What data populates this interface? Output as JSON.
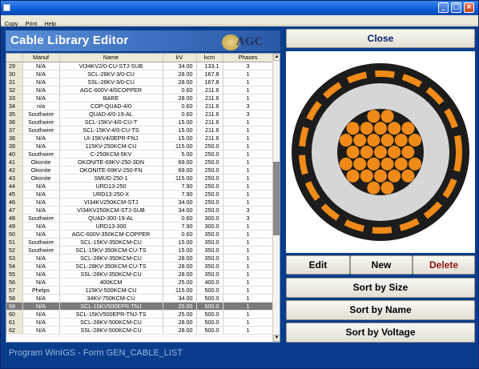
{
  "window": {
    "title": ""
  },
  "menu": [
    "Copy",
    "Print",
    "Help"
  ],
  "header": {
    "title": "Cable Library Editor",
    "logo_text": "AGC"
  },
  "buttons": {
    "close": "Close",
    "edit": "Edit",
    "new": "New",
    "delete": "Delete",
    "sort_size": "Sort by Size",
    "sort_name": "Sort by Name",
    "sort_voltage": "Sort by Voltage"
  },
  "status": "Program WinIGS - Form GEN_CABLE_LIST",
  "table": {
    "columns": [
      "",
      "Manuf",
      "Name",
      "kV",
      "kcm",
      "Phases"
    ],
    "rows": [
      [
        "29",
        "N/A",
        "VI34KV2/0-CU-STJ-SUB",
        "34.00",
        "133.1",
        "3"
      ],
      [
        "30",
        "N/A",
        "SCL-28KV-3/0-CU",
        "28.00",
        "167.8",
        "1"
      ],
      [
        "31",
        "N/A",
        "SSL-28KV-3/0-CU",
        "28.00",
        "167.8",
        "1"
      ],
      [
        "32",
        "N/A",
        "AGC-600V-4/0COPPER",
        "0.60",
        "211.6",
        "1"
      ],
      [
        "33",
        "N/A",
        "BARE",
        "28.00",
        "211.6",
        "1"
      ],
      [
        "34",
        "n/a",
        "COP-QUAD-4/0",
        "0.60",
        "211.6",
        "3"
      ],
      [
        "35",
        "Southwire",
        "QUAD-4/0-19-AL",
        "0.60",
        "211.6",
        "3"
      ],
      [
        "36",
        "Southwire",
        "SCL-15KV-4/0-CU-T",
        "15.00",
        "211.6",
        "1"
      ],
      [
        "37",
        "Southwire",
        "SCL-15KV-4/0-CU-TS",
        "15.00",
        "211.6",
        "1"
      ],
      [
        "38",
        "N/A",
        "UI-15KV4/0EPR-FNJ",
        "15.00",
        "211.6",
        "1"
      ],
      [
        "39",
        "N/A",
        "115KV-250KCM-CU",
        "115.00",
        "250.0",
        "1"
      ],
      [
        "40",
        "Southwire",
        "C-250KCM-5KV",
        "5.00",
        "250.0",
        "1"
      ],
      [
        "41",
        "Okonite",
        "OKONITE-69KV-250-3DN",
        "69.00",
        "250.0",
        "1"
      ],
      [
        "42",
        "Okonite",
        "OKONITE-69KV-250-FN",
        "69.00",
        "250.0",
        "1"
      ],
      [
        "43",
        "Okonite",
        "SMUD-250-1",
        "115.00",
        "250.0",
        "1"
      ],
      [
        "44",
        "N/A",
        "URD13-250",
        "7.90",
        "250.0",
        "1"
      ],
      [
        "45",
        "N/A",
        "URD13-250-X",
        "7.90",
        "250.0",
        "1"
      ],
      [
        "46",
        "N/A",
        "VI34KV250KCM-STJ",
        "34.00",
        "250.0",
        "1"
      ],
      [
        "47",
        "N/A",
        "VI34KV250KCM-STJ-SUB",
        "34.00",
        "250.0",
        "3"
      ],
      [
        "48",
        "Southwire",
        "QUAD-300-19-AL",
        "0.60",
        "300.0",
        "3"
      ],
      [
        "49",
        "N/A",
        "URD13-300",
        "7.90",
        "300.0",
        "1"
      ],
      [
        "50",
        "N/A",
        "AGC-600V-350KCM-COPPER",
        "0.60",
        "350.0",
        "1"
      ],
      [
        "51",
        "Southwire",
        "SCL-15KV-350KCM-CU",
        "15.00",
        "350.0",
        "1"
      ],
      [
        "52",
        "Southwire",
        "SCL-15KV-350KCM-CU-TS",
        "15.00",
        "350.0",
        "1"
      ],
      [
        "53",
        "N/A",
        "SCL-28KV-350KCM-CU",
        "28.00",
        "350.0",
        "1"
      ],
      [
        "54",
        "N/A",
        "SCL-28KV-350KCM-CU-TS",
        "28.00",
        "350.0",
        "1"
      ],
      [
        "55",
        "N/A",
        "SSL-28KV-350KCM-CU",
        "28.00",
        "350.0",
        "1"
      ],
      [
        "56",
        "N/A",
        "400KCM",
        "25.00",
        "400.0",
        "1"
      ],
      [
        "57",
        "Phelps",
        "115KV-500KCM-CU",
        "115.00",
        "500.0",
        "1"
      ],
      [
        "58",
        "N/A",
        "34KV-750KCM-CU",
        "34.00",
        "500.0",
        "1"
      ],
      [
        "59",
        "N/A",
        "SCL-15KV500EPR-TNJ",
        "25.00",
        "500.0",
        "1"
      ],
      [
        "60",
        "N/A",
        "SCL-15KV500EPR-TNJ-TS",
        "25.00",
        "500.0",
        "1"
      ],
      [
        "61",
        "N/A",
        "SCL-28KV-500KCM-CU",
        "28.00",
        "500.0",
        "1"
      ],
      [
        "62",
        "N/A",
        "SSL-28KV-500KCM-CU",
        "28.00",
        "500.0",
        "1"
      ]
    ],
    "selected_row": "59"
  },
  "colors": {
    "panel": "#0a3c8c",
    "conductor": "#f08a18",
    "shield": "#f08a18",
    "jacket": "#1a1a1a",
    "insulation": "#d8d8d8",
    "selected_row": "#7a7a7a"
  },
  "icons": {
    "scroll_up": "arrow-up-icon",
    "scroll_down": "arrow-down-icon"
  }
}
